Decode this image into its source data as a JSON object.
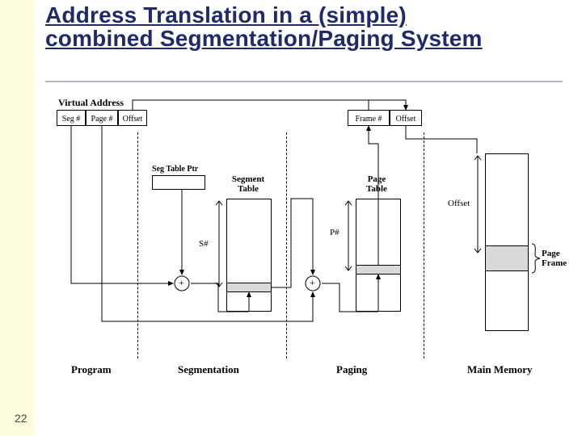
{
  "title": "Address Translation in a (simple) combined Segmentation/Paging System",
  "page_number": "22",
  "diagram": {
    "va_label": "Virtual Address",
    "va_fields": {
      "seg": "Seg #",
      "page": "Page #",
      "offset": "Offset"
    },
    "seg_ptr": "Seg Table Ptr",
    "seg_table": "Segment\nTable",
    "page_table": "Page\nTable",
    "s_num": "S#",
    "p_num": "P#",
    "adder": "+",
    "phys_fields": {
      "frame": "Frame #",
      "offset": "Offset"
    },
    "mem_offset": "Offset",
    "page_frame": "Page\nFrame",
    "sections": {
      "program": "Program",
      "segmentation": "Segmentation",
      "paging": "Paging",
      "main_memory": "Main Memory"
    }
  }
}
